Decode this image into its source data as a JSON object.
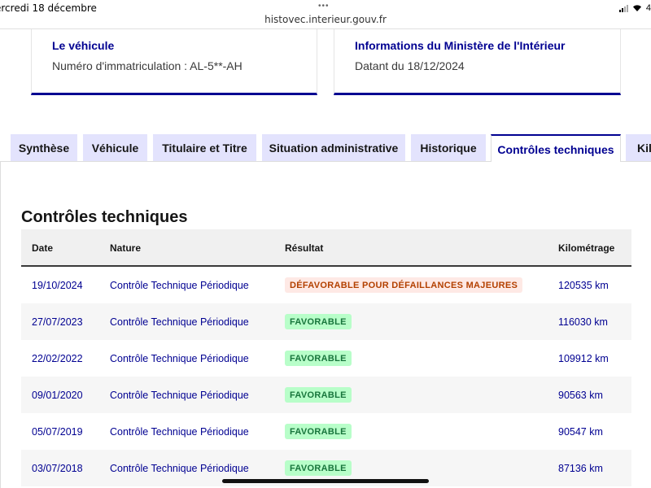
{
  "status_bar": {
    "time": "ercredi 18 décembre",
    "dots": "•••",
    "url": "histovec.interieur.gouv.fr",
    "battery": "4"
  },
  "cards": {
    "vehicle": {
      "title": "Le véhicule",
      "text": "Numéro d'immatriculation : AL-5**-AH"
    },
    "ministry": {
      "title": "Informations du Ministère de l'Intérieur",
      "text": "Datant du 18/12/2024"
    }
  },
  "tabs": [
    {
      "label": "Synthèse"
    },
    {
      "label": "Véhicule"
    },
    {
      "label": "Titulaire et Titre"
    },
    {
      "label": "Situation administrative"
    },
    {
      "label": "Historique"
    },
    {
      "label": "Contrôles techniques"
    },
    {
      "label": "Kil"
    }
  ],
  "active_tab": "Contrôles techniques",
  "section": {
    "title": "Contrôles techniques"
  },
  "table": {
    "headers": {
      "date": "Date",
      "nature": "Nature",
      "result": "Résultat",
      "km": "Kilométrage"
    },
    "rows": [
      {
        "date": "19/10/2024",
        "nature": "Contrôle Technique Périodique",
        "result": "DÉFAVORABLE POUR DÉFAILLANCES MAJEURES",
        "status": "ko",
        "km": "120535 km"
      },
      {
        "date": "27/07/2023",
        "nature": "Contrôle Technique Périodique",
        "result": "FAVORABLE",
        "status": "ok",
        "km": "116030 km"
      },
      {
        "date": "22/02/2022",
        "nature": "Contrôle Technique Périodique",
        "result": "FAVORABLE",
        "status": "ok",
        "km": "109912 km"
      },
      {
        "date": "09/01/2020",
        "nature": "Contrôle Technique Périodique",
        "result": "FAVORABLE",
        "status": "ok",
        "km": "90563 km"
      },
      {
        "date": "05/07/2019",
        "nature": "Contrôle Technique Périodique",
        "result": "FAVORABLE",
        "status": "ok",
        "km": "90547 km"
      },
      {
        "date": "03/07/2018",
        "nature": "Contrôle Technique Périodique",
        "result": "FAVORABLE",
        "status": "ok",
        "km": "87136 km"
      }
    ]
  },
  "colors": {
    "brand_blue": "#000091",
    "tab_bg": "#e3e3fd",
    "favorable_bg": "#b8fec9",
    "favorable_text": "#18753c",
    "defavorable_bg": "#fee9e5",
    "defavorable_text": "#b34000"
  }
}
